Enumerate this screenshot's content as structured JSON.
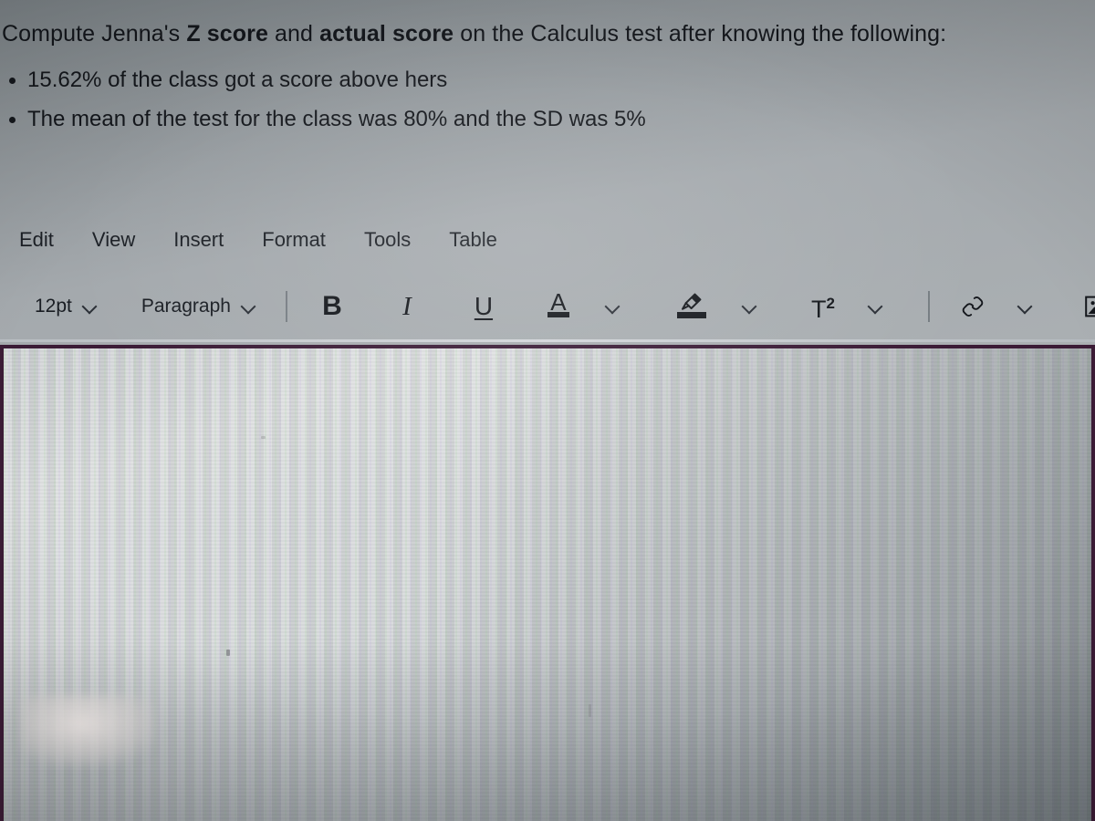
{
  "question": {
    "line1_pre": "Compute Jenna's ",
    "line1_b1": "Z score",
    "line1_mid": " and ",
    "line1_b2": "actual score",
    "line1_post": " on the Calculus test after knowing the following:",
    "bullets": [
      "15.62% of the class got a score above hers",
      "The mean of the test for the class was 80% and the SD was 5%"
    ]
  },
  "menubar": {
    "items": [
      {
        "label": "Edit"
      },
      {
        "label": "View"
      },
      {
        "label": "Insert"
      },
      {
        "label": "Format"
      },
      {
        "label": "Tools"
      },
      {
        "label": "Table"
      }
    ]
  },
  "toolbar": {
    "font_size_value": "12pt",
    "paragraph_value": "Paragraph",
    "bold_label": "B",
    "italic_label": "I",
    "underline_label": "U",
    "text_color_label": "A",
    "superscript_label": "T",
    "superscript_exponent": "2",
    "icons": {
      "highlighter": "highlighter-icon",
      "link": "link-icon",
      "image": "image-icon",
      "document": "document-icon",
      "chevron": "chevron-down-icon"
    }
  },
  "editor": {
    "content": "",
    "placeholder": ""
  },
  "colors": {
    "editor_border": "#3b1b36",
    "page_background": "#a4a9ad",
    "text": "#14171c",
    "separator": "#6e757b"
  }
}
